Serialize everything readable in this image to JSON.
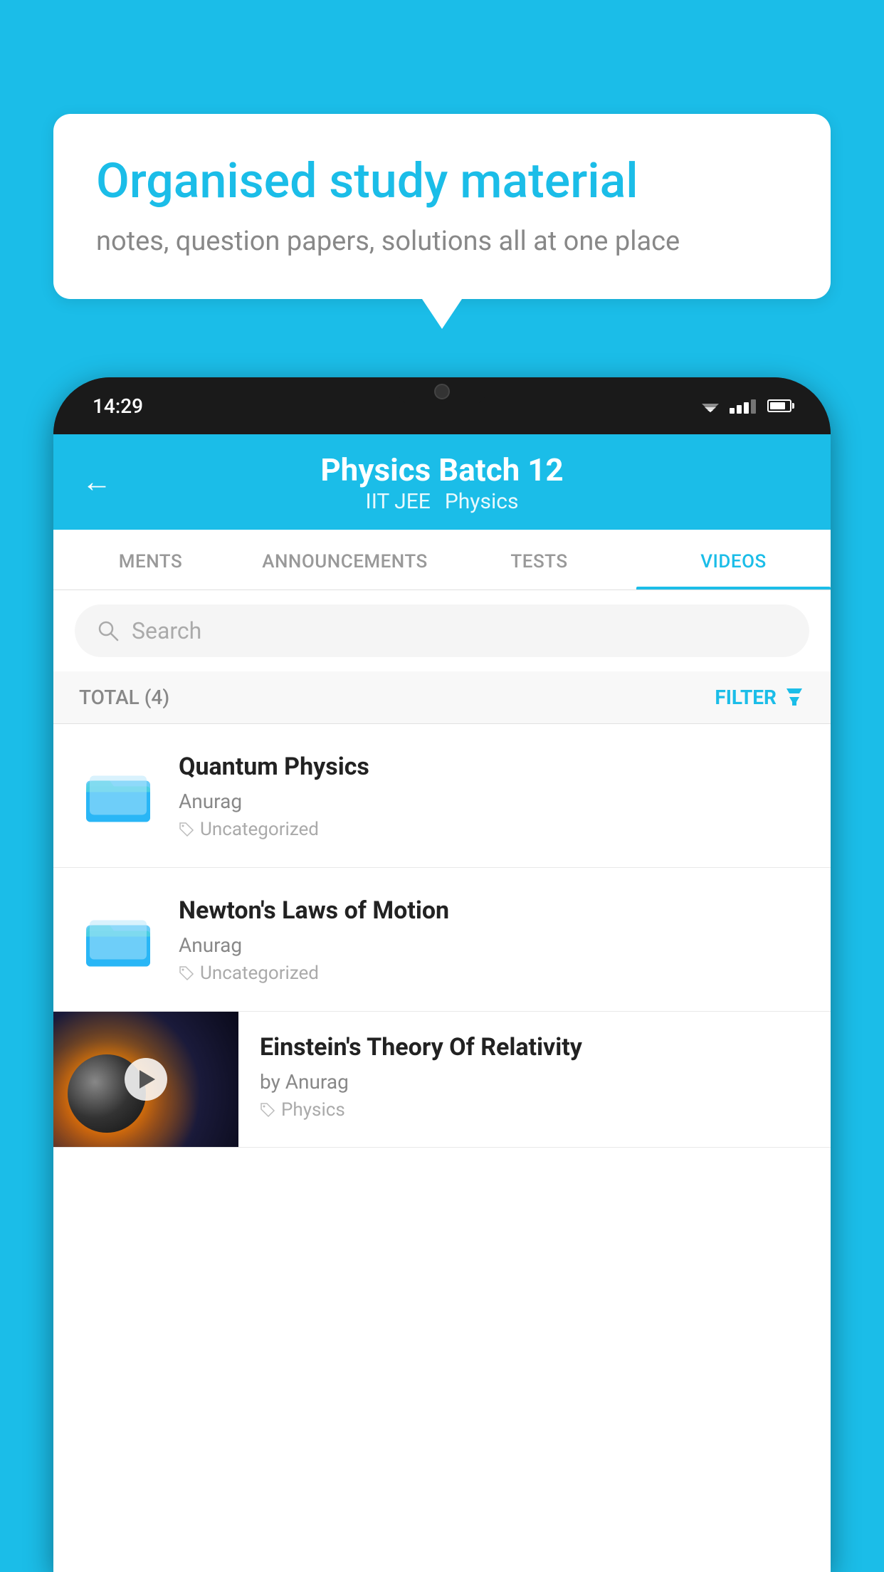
{
  "background_color": "#1BBDE8",
  "speech_bubble": {
    "title": "Organised study material",
    "subtitle": "notes, question papers, solutions all at one place"
  },
  "status_bar": {
    "time": "14:29"
  },
  "app_header": {
    "title": "Physics Batch 12",
    "subtitle_left": "IIT JEE",
    "subtitle_right": "Physics",
    "back_label": "←"
  },
  "tabs": [
    {
      "label": "MENTS",
      "active": false
    },
    {
      "label": "ANNOUNCEMENTS",
      "active": false
    },
    {
      "label": "TESTS",
      "active": false
    },
    {
      "label": "VIDEOS",
      "active": true
    }
  ],
  "search": {
    "placeholder": "Search"
  },
  "filter": {
    "total_label": "TOTAL (4)",
    "filter_label": "FILTER"
  },
  "video_items": [
    {
      "title": "Quantum Physics",
      "author": "Anurag",
      "tag": "Uncategorized",
      "type": "folder"
    },
    {
      "title": "Newton's Laws of Motion",
      "author": "Anurag",
      "tag": "Uncategorized",
      "type": "folder"
    },
    {
      "title": "Einstein's Theory Of Relativity",
      "author": "by Anurag",
      "tag": "Physics",
      "type": "video"
    }
  ]
}
